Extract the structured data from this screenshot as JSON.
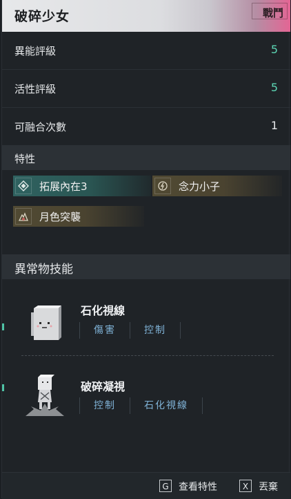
{
  "header": {
    "title": "破碎少女",
    "tag": "戰鬥"
  },
  "stats": [
    {
      "label": "異能評級",
      "value": "5"
    },
    {
      "label": "活性評級",
      "value": "5"
    },
    {
      "label": "可融合次數",
      "value": "1"
    }
  ],
  "traits_section": {
    "title": "特性",
    "traits": [
      {
        "label": "拓展內在3",
        "icon": "diamond-icon",
        "style": "teal"
      },
      {
        "label": "念力小子",
        "icon": "psychic-swirl-icon",
        "style": "gold"
      },
      {
        "label": "月色突襲",
        "icon": "moon-strike-icon",
        "style": "gold"
      }
    ]
  },
  "skills_section": {
    "title": "異常物技能",
    "skills": [
      {
        "name": "石化視線",
        "icon": "block-face-icon",
        "tags": [
          "傷害",
          "控制"
        ]
      },
      {
        "name": "破碎凝視",
        "icon": "broken-girl-icon",
        "tags": [
          "控制",
          "石化視線"
        ]
      }
    ]
  },
  "footer": {
    "actions": [
      {
        "key": "G",
        "label": "查看特性"
      },
      {
        "key": "X",
        "label": "丟棄"
      }
    ]
  },
  "colors": {
    "accent": "#5cd6b4",
    "tag_text": "#7fb2d6",
    "header_pink": "#e36594"
  }
}
